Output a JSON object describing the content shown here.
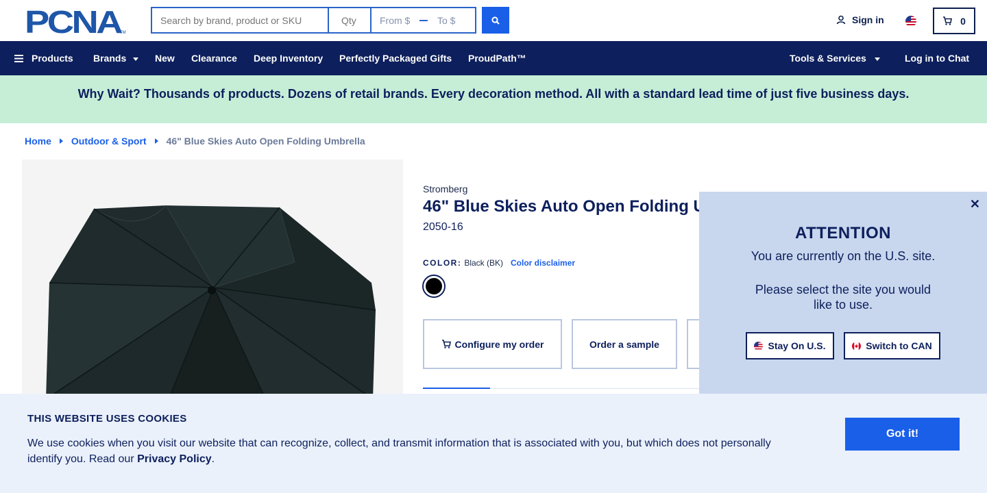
{
  "header": {
    "logo_text": "PCNA",
    "search": {
      "placeholder": "Search by brand, product or SKU"
    },
    "qty": {
      "placeholder": "Qty"
    },
    "price": {
      "from_placeholder": "From $",
      "to_placeholder": "To $"
    },
    "signin_label": "Sign in",
    "cart_count": "0"
  },
  "nav": {
    "products": "Products",
    "brands": "Brands",
    "new": "New",
    "clearance": "Clearance",
    "deep_inventory": "Deep Inventory",
    "gifts": "Perfectly Packaged Gifts",
    "proudpath": "ProudPath™",
    "tools": "Tools & Services",
    "chat": "Log in to Chat"
  },
  "promo": {
    "text": "Why Wait? Thousands of products. Dozens of retail brands. Every decoration method. All with a standard lead time of just five business days."
  },
  "breadcrumb": {
    "home": "Home",
    "category": "Outdoor & Sport",
    "current": "46\" Blue Skies Auto Open Folding Umbrella"
  },
  "product": {
    "brand": "Stromberg",
    "title": "46\" Blue Skies Auto Open Folding U",
    "sku": "2050-16",
    "color_label": "COLOR:",
    "color_value": "Black (BK)",
    "color_disclaimer": "Color disclaimer",
    "swatch_color": "#000000",
    "configure_label": "Configure my order",
    "sample_label": "Order a sample"
  },
  "region_modal": {
    "heading": "ATTENTION",
    "line1": "You are currently on the U.S. site.",
    "line2": "Please select the site you would like to use.",
    "stay_label": "Stay On U.S.",
    "switch_label": "Switch to CAN"
  },
  "cookie": {
    "title": "THIS WEBSITE USES COOKIES",
    "text": "We use cookies when you visit our website that can recognize, collect, and transmit information that is associated with you, but which does not personally identify you. Read our",
    "link": "Privacy Policy",
    "period": ".",
    "button": "Got it!"
  },
  "colors": {
    "navy": "#0d1f5c",
    "accent_blue": "#1a5fe8",
    "promo_green": "#c6eed7",
    "modal_bg": "#c8d7ee",
    "cookie_bg": "#eaf1fb"
  }
}
